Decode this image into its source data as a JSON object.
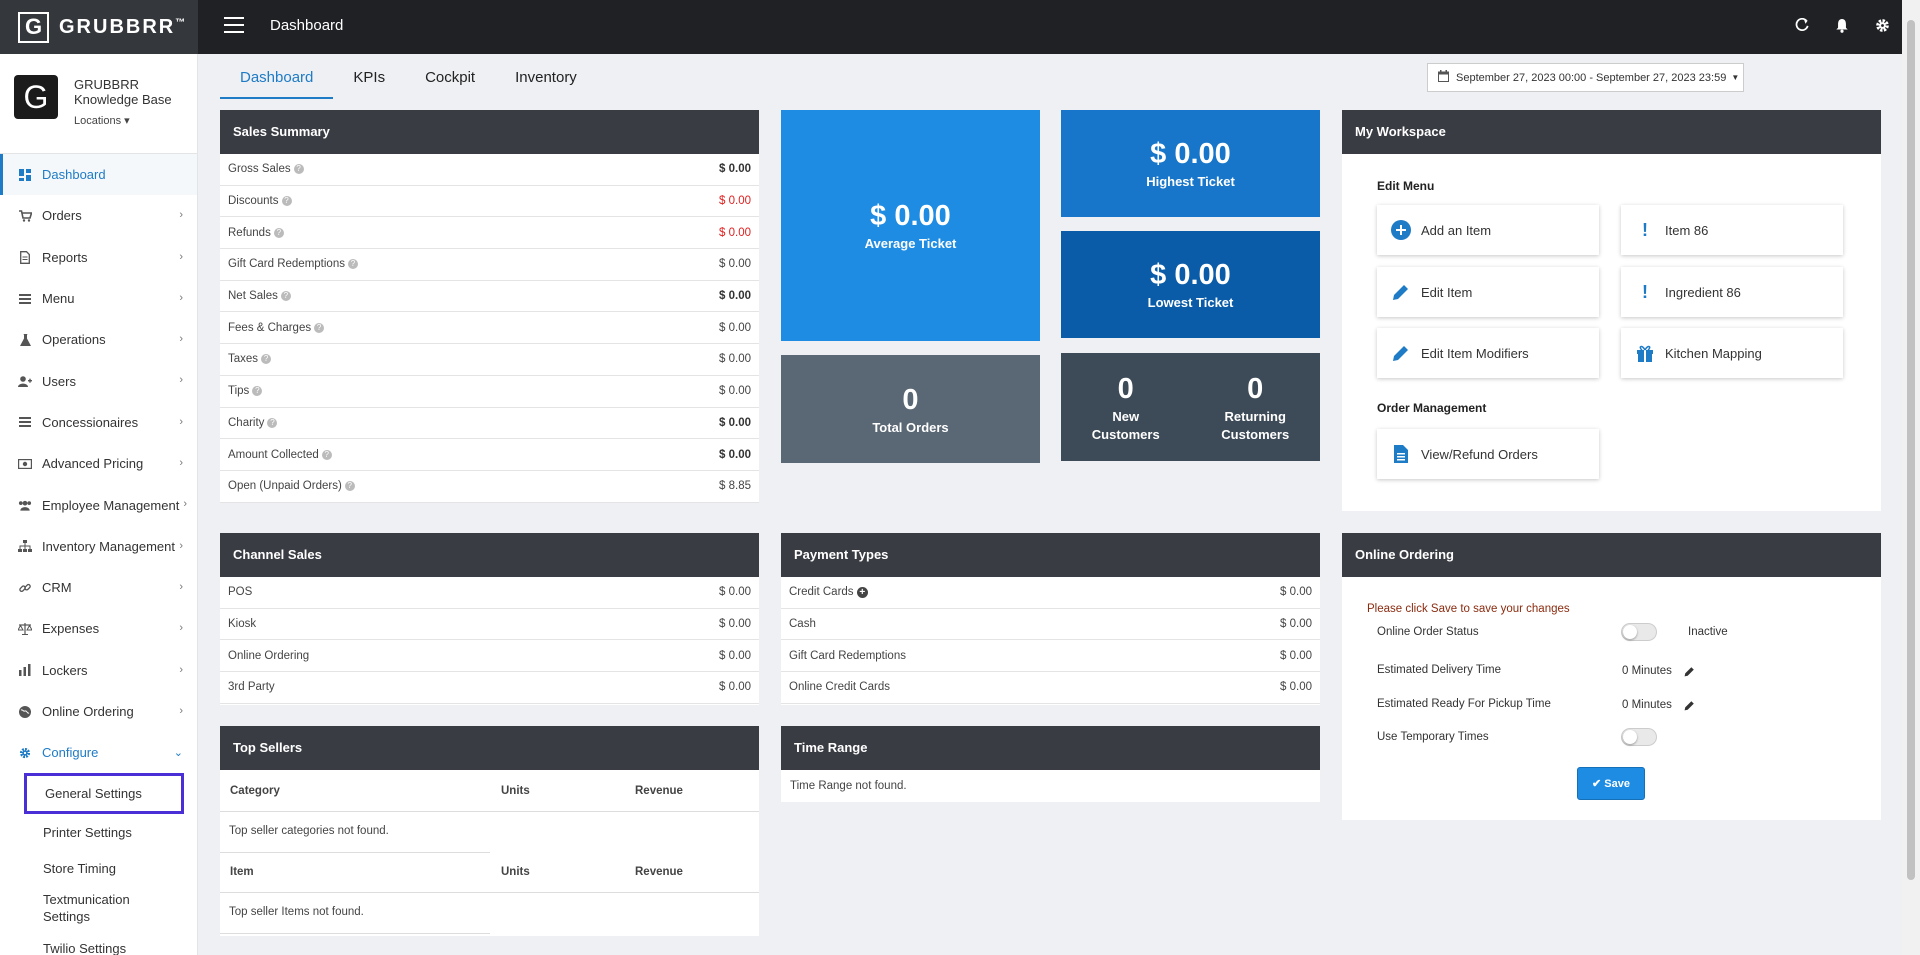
{
  "app": {
    "brand": "GRUBBRR",
    "brand_tm": "™",
    "logo_letter": "G",
    "page_title": "Dashboard"
  },
  "profile": {
    "avatar_letter": "G",
    "name_line1": "GRUBBRR",
    "name_line2": "Knowledge Base",
    "locations": "Locations ▾"
  },
  "nav": {
    "items": [
      {
        "label": "Dashboard",
        "icon": "dashboard-icon"
      },
      {
        "label": "Orders",
        "icon": "cart-icon"
      },
      {
        "label": "Reports",
        "icon": "file-icon"
      },
      {
        "label": "Menu",
        "icon": "list-icon"
      },
      {
        "label": "Operations",
        "icon": "flask-icon"
      },
      {
        "label": "Users",
        "icon": "user-plus-icon"
      },
      {
        "label": "Concessionaires",
        "icon": "list-icon"
      },
      {
        "label": "Advanced Pricing",
        "icon": "money-icon"
      },
      {
        "label": "Employee Management",
        "icon": "users-icon"
      },
      {
        "label": "Inventory Management",
        "icon": "sitemap-icon"
      },
      {
        "label": "CRM",
        "icon": "link-icon"
      },
      {
        "label": "Expenses",
        "icon": "balance-icon"
      },
      {
        "label": "Lockers",
        "icon": "chart-icon"
      },
      {
        "label": "Online Ordering",
        "icon": "globe-icon"
      },
      {
        "label": "Configure",
        "icon": "gear-icon"
      }
    ],
    "sub_items": [
      "General Settings",
      "Printer Settings",
      "Store Timing",
      "Textmunication Settings",
      "Twilio Settings"
    ]
  },
  "tabs": [
    "Dashboard",
    "KPIs",
    "Cockpit",
    "Inventory"
  ],
  "date_range": "September 27, 2023 00:00 - September 27, 2023 23:59",
  "sales_summary": {
    "title": "Sales Summary",
    "rows": [
      {
        "label": "Gross Sales",
        "value": "$ 0.00"
      },
      {
        "label": "Discounts",
        "value": "$ 0.00"
      },
      {
        "label": "Refunds",
        "value": "$ 0.00"
      },
      {
        "label": "Gift Card Redemptions",
        "value": "$ 0.00"
      },
      {
        "label": "Net Sales",
        "value": "$ 0.00"
      },
      {
        "label": "Fees & Charges",
        "value": "$ 0.00"
      },
      {
        "label": "Taxes",
        "value": "$ 0.00"
      },
      {
        "label": "Tips",
        "value": "$ 0.00"
      },
      {
        "label": "Charity",
        "value": "$ 0.00"
      },
      {
        "label": "Amount Collected",
        "value": "$ 0.00"
      },
      {
        "label": "Open (Unpaid Orders)",
        "value": "$ 8.85"
      }
    ]
  },
  "tiles": {
    "average": {
      "value": "$ 0.00",
      "label": "Average Ticket"
    },
    "highest": {
      "value": "$ 0.00",
      "label": "Highest Ticket"
    },
    "lowest": {
      "value": "$ 0.00",
      "label": "Lowest Ticket"
    },
    "total_orders": {
      "value": "0",
      "label": "Total Orders"
    },
    "new_customers": {
      "value": "0",
      "label1": "New",
      "label2": "Customers"
    },
    "returning_customers": {
      "value": "0",
      "label1": "Returning",
      "label2": "Customers"
    }
  },
  "workspace": {
    "title": "My Workspace",
    "edit_menu": "Edit Menu",
    "order_management": "Order Management",
    "buttons": {
      "add_item": "Add an Item",
      "item86": "Item 86",
      "edit_item": "Edit Item",
      "ingredient86": "Ingredient 86",
      "edit_modifiers": "Edit Item Modifiers",
      "kitchen_mapping": "Kitchen Mapping",
      "view_refund": "View/Refund Orders"
    }
  },
  "channel_sales": {
    "title": "Channel Sales",
    "rows": [
      {
        "label": "POS",
        "value": "$ 0.00"
      },
      {
        "label": "Kiosk",
        "value": "$ 0.00"
      },
      {
        "label": "Online Ordering",
        "value": "$ 0.00"
      },
      {
        "label": "3rd Party",
        "value": "$ 0.00"
      }
    ]
  },
  "payment_types": {
    "title": "Payment Types",
    "rows": [
      {
        "label": "Credit Cards",
        "value": "$ 0.00"
      },
      {
        "label": "Cash",
        "value": "$ 0.00"
      },
      {
        "label": "Gift Card Redemptions",
        "value": "$ 0.00"
      },
      {
        "label": "Online Credit Cards",
        "value": "$ 0.00"
      }
    ]
  },
  "online_ordering": {
    "title": "Online Ordering",
    "notice": "Please click Save to save your changes",
    "status_label": "Online Order Status",
    "status_value": "Inactive",
    "delivery_label": "Estimated Delivery Time",
    "delivery_value": "0 Minutes",
    "pickup_label": "Estimated Ready For Pickup Time",
    "pickup_value": "0 Minutes",
    "temp_label": "Use Temporary Times",
    "save": "Save"
  },
  "top_sellers": {
    "title": "Top Sellers",
    "cat_headers": [
      "Category",
      "Units",
      "Revenue"
    ],
    "cat_empty": "Top seller categories not found.",
    "item_headers": [
      "Item",
      "Units",
      "Revenue"
    ],
    "item_empty": "Top seller Items not found."
  },
  "time_range": {
    "title": "Time Range",
    "empty": "Time Range not found."
  },
  "colors": {
    "accent": "#1e7bc6",
    "tile_blue": "#1e8ce3",
    "tile_mid": "#1776c9",
    "tile_dark": "#0b5ca8",
    "tile_gray": "#5a6774",
    "tile_slate": "#3d4a57",
    "header": "#393c43",
    "highlight": "#4b2fd6"
  }
}
